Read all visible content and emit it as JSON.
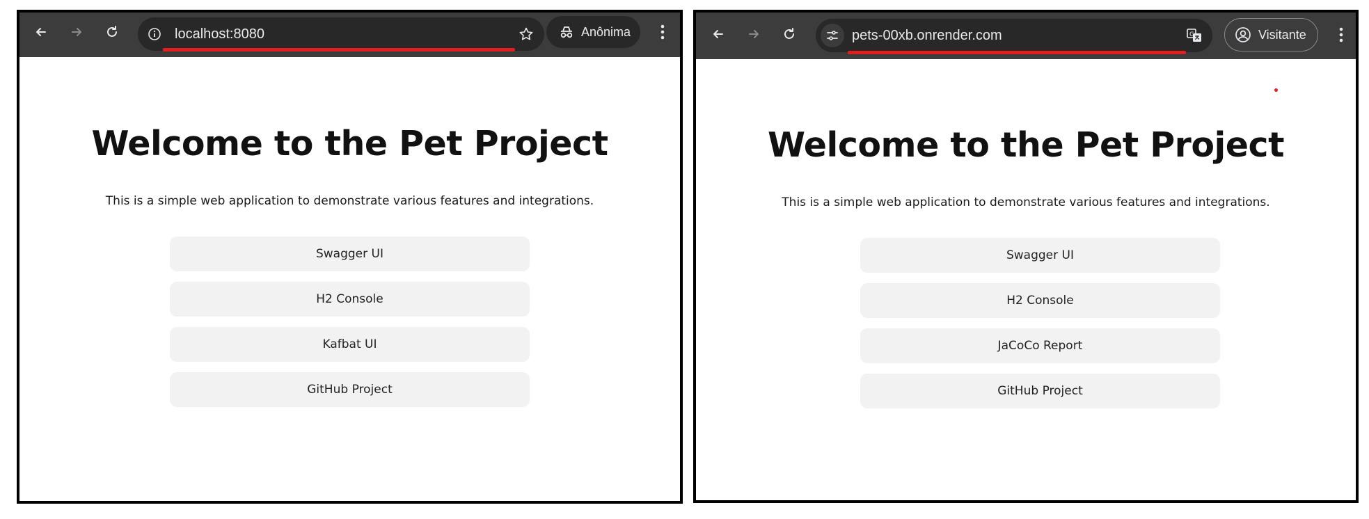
{
  "left_window": {
    "address_bar": {
      "url": "localhost:8080"
    },
    "profile": {
      "label": "Anônima",
      "icon": "incognito-icon"
    },
    "page": {
      "title": "Welcome to the Pet Project",
      "description": "This is a simple web application to demonstrate various features and integrations.",
      "links": [
        "Swagger UI",
        "H2 Console",
        "Kafbat UI",
        "GitHub Project"
      ]
    }
  },
  "right_window": {
    "address_bar": {
      "url": "pets-00xb.onrender.com"
    },
    "profile": {
      "label": "Visitante",
      "icon": "account-circle-icon"
    },
    "page": {
      "title": "Welcome to the Pet Project",
      "description": "This is a simple web application to demonstrate various features and integrations.",
      "links": [
        "Swagger UI",
        "H2 Console",
        "JaCoCo Report",
        "GitHub Project"
      ]
    }
  },
  "colors": {
    "toolbar": "#3c3c3c",
    "omnibox": "#282828",
    "annotation_red": "#e0201f",
    "button_bg": "#f2f2f2"
  }
}
